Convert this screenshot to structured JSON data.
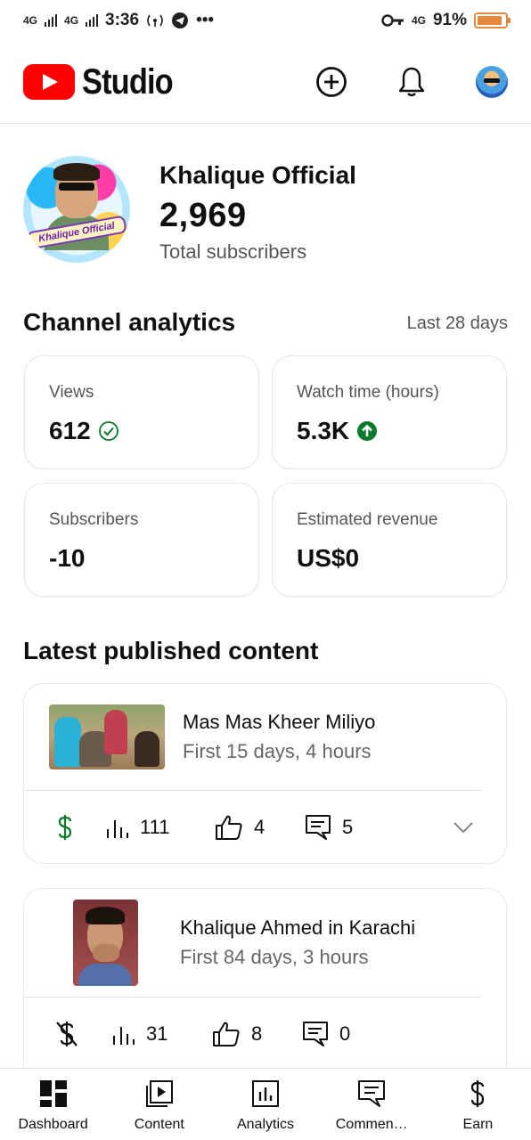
{
  "status_bar": {
    "network_1": "4G",
    "network_2": "4G",
    "time": "3:36",
    "dots": "•••",
    "network_3": "4G",
    "battery_text": "91%",
    "battery_level": 0.91
  },
  "app_bar": {
    "brand": "Studio"
  },
  "channel": {
    "name": "Khalique Official",
    "subscriber_count": "2,969",
    "subscriber_label": "Total subscribers",
    "avatar_text": "Khalique Official"
  },
  "analytics": {
    "title": "Channel analytics",
    "period": "Last 28 days",
    "cards": [
      {
        "label": "Views",
        "value": "612"
      },
      {
        "label": "Watch time (hours)",
        "value": "5.3K"
      },
      {
        "label": "Subscribers",
        "value": "-10"
      },
      {
        "label": "Estimated revenue",
        "value": "US$0"
      }
    ]
  },
  "latest": {
    "title": "Latest published content",
    "items": [
      {
        "title": "Mas Mas Kheer Miliyo",
        "subtitle": "First 15 days, 4 hours",
        "views": "111",
        "likes": "4",
        "comments": "5"
      },
      {
        "title": "Khalique Ahmed in Karachi",
        "subtitle": "First 84 days, 3 hours",
        "views": "31",
        "likes": "8",
        "comments": "0"
      }
    ]
  },
  "bottom_nav": [
    {
      "label": "Dashboard",
      "icon": "dashboard-icon"
    },
    {
      "label": "Content",
      "icon": "content-icon"
    },
    {
      "label": "Analytics",
      "icon": "analytics-icon"
    },
    {
      "label": "Commen…",
      "icon": "comments-icon"
    },
    {
      "label": "Earn",
      "icon": "dollar-icon"
    }
  ],
  "colors": {
    "brand_red": "#ff0000",
    "success_green": "#0a7a2a",
    "monetized_green": "#0a7a2a",
    "battery": "#e5873a"
  }
}
